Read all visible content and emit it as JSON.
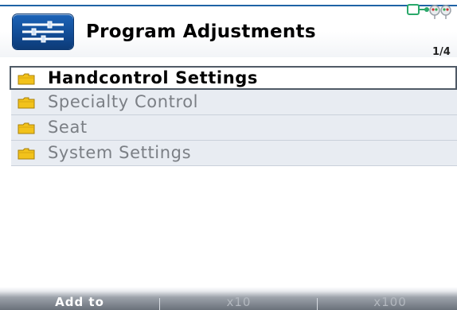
{
  "header": {
    "title": "Program Adjustments",
    "page_indicator": "1/4",
    "app_icon": "sliders-icon",
    "status_icon": "connection-icon",
    "accent_color": "#1f63a6"
  },
  "menu": {
    "items": [
      {
        "label": "Handcontrol Settings",
        "icon": "folder-icon",
        "selected": true
      },
      {
        "label": "Specialty Control",
        "icon": "folder-icon",
        "selected": false
      },
      {
        "label": "Seat",
        "icon": "folder-icon",
        "selected": false
      },
      {
        "label": "System Settings",
        "icon": "folder-icon",
        "selected": false
      }
    ]
  },
  "softkeys": {
    "add_to": "Add to",
    "x10": "x10",
    "x100": "x100"
  }
}
